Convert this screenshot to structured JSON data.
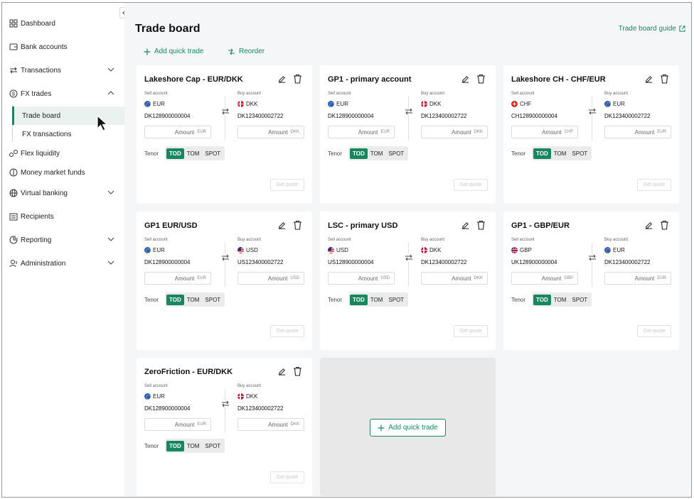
{
  "sidebar": {
    "items": [
      {
        "label": "Dashboard",
        "icon": "dashboard-icon"
      },
      {
        "label": "Bank accounts",
        "icon": "bank-accounts-icon"
      },
      {
        "label": "Transactions",
        "icon": "transactions-icon",
        "expandable": true
      },
      {
        "label": "FX trades",
        "icon": "fx-trades-icon",
        "expanded": true
      },
      {
        "label": "Flex liquidity",
        "icon": "flex-liquidity-icon"
      },
      {
        "label": "Money market funds",
        "icon": "money-market-icon"
      },
      {
        "label": "Virtual banking",
        "icon": "globe-icon",
        "expandable": true
      },
      {
        "label": "Recipients",
        "icon": "recipients-icon"
      },
      {
        "label": "Reporting",
        "icon": "reporting-icon",
        "expandable": true
      },
      {
        "label": "Administration",
        "icon": "administration-icon",
        "expandable": true
      }
    ],
    "fx_sub": [
      {
        "label": "Trade board",
        "active": true
      },
      {
        "label": "FX transactions",
        "active": false
      }
    ]
  },
  "header": {
    "title": "Trade board",
    "guide_label": "Trade board guide"
  },
  "toolbar": {
    "add_label": "Add quick trade",
    "reorder_label": "Reorder"
  },
  "labels": {
    "sell": "Sell account",
    "buy": "Buy account",
    "amount": "Amount",
    "tenor": "Tenor",
    "get_quote": "Get quote"
  },
  "tenor_options": [
    "TOD",
    "TOM",
    "SPOT"
  ],
  "cards": [
    {
      "title": "Lakeshore Cap - EUR/DKK",
      "sell": {
        "currency": "EUR",
        "account": "DK128900000004",
        "flag": "eu"
      },
      "buy": {
        "currency": "DKK",
        "account": "DK123400002722",
        "flag": "dk"
      },
      "tenor": "TOD"
    },
    {
      "title": "GP1 - primary account",
      "sell": {
        "currency": "EUR",
        "account": "DK128900000004",
        "flag": "eu"
      },
      "buy": {
        "currency": "DKK",
        "account": "DK123400002722",
        "flag": "dk"
      },
      "tenor": "TOD"
    },
    {
      "title": "Lakeshore CH - CHF/EUR",
      "sell": {
        "currency": "CHF",
        "account": "CH128900000004",
        "flag": "ch"
      },
      "buy": {
        "currency": "EUR",
        "account": "DK123400002722",
        "flag": "eu"
      },
      "tenor": "TOD"
    },
    {
      "title": "GP1 EUR/USD",
      "sell": {
        "currency": "EUR",
        "account": "DK128900000004",
        "flag": "eu"
      },
      "buy": {
        "currency": "USD",
        "account": "US123400002722",
        "flag": "us"
      },
      "tenor": "TOD"
    },
    {
      "title": "LSC - primary USD",
      "sell": {
        "currency": "USD",
        "account": "US128900000004",
        "flag": "us"
      },
      "buy": {
        "currency": "DKK",
        "account": "DK123400002722",
        "flag": "dk"
      },
      "tenor": "TOD"
    },
    {
      "title": "GP1 - GBP/EUR",
      "sell": {
        "currency": "GBP",
        "account": "UK128900000004",
        "flag": "gb"
      },
      "buy": {
        "currency": "EUR",
        "account": "DK123400002722",
        "flag": "eu"
      },
      "tenor": "TOD"
    },
    {
      "title": "ZeroFriction - EUR/DKK",
      "sell": {
        "currency": "EUR",
        "account": "DK128900000004",
        "flag": "eu"
      },
      "buy": {
        "currency": "DKK",
        "account": "DK123400002722",
        "flag": "dk"
      },
      "tenor": "TOD"
    }
  ],
  "add_card": {
    "label": "Add quick trade"
  },
  "colors": {
    "accent": "#18875f",
    "background": "#f5f6f7",
    "card": "#ffffff",
    "add_card": "#e8e8e8"
  }
}
